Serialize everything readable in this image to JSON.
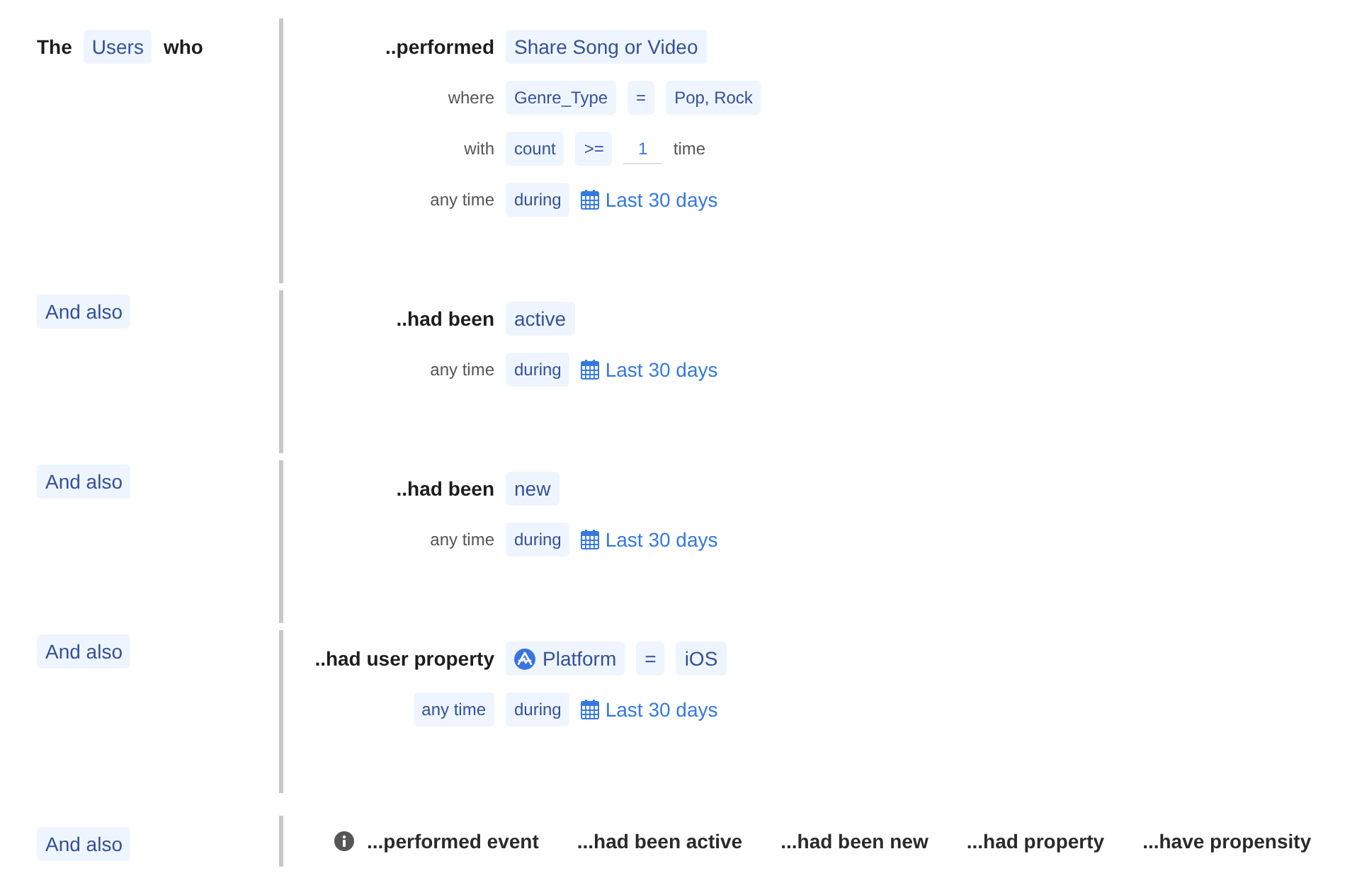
{
  "sections": [
    {
      "kind": "condition",
      "lead": {
        "kind": "intro",
        "words": [
          {
            "kind": "text",
            "text": "The"
          },
          {
            "kind": "pill",
            "text": "Users"
          },
          {
            "kind": "text",
            "text": "who"
          }
        ]
      },
      "rows": [
        {
          "label": {
            "kind": "heading",
            "text": "..performed"
          },
          "parts": [
            {
              "kind": "pill",
              "text": "Share Song or Video"
            }
          ]
        },
        {
          "label": {
            "kind": "plain",
            "text": "where"
          },
          "parts": [
            {
              "kind": "pill",
              "text": "Genre_Type"
            },
            {
              "kind": "pill",
              "text": "="
            },
            {
              "kind": "pill",
              "text": "Pop, Rock"
            }
          ]
        },
        {
          "label": {
            "kind": "plain",
            "text": "with"
          },
          "parts": [
            {
              "kind": "pill",
              "text": "count"
            },
            {
              "kind": "pill",
              "text": ">="
            },
            {
              "kind": "input",
              "text": "1"
            },
            {
              "kind": "text",
              "text": "time"
            }
          ]
        },
        {
          "label": {
            "kind": "plain",
            "text": "any time"
          },
          "parts": [
            {
              "kind": "pill",
              "text": "during"
            },
            {
              "kind": "date",
              "text": "Last 30 days"
            }
          ]
        }
      ]
    },
    {
      "kind": "condition",
      "lead": {
        "kind": "connector",
        "words": [
          {
            "kind": "pill",
            "text": "And also"
          }
        ]
      },
      "rows": [
        {
          "label": {
            "kind": "heading",
            "text": "..had been"
          },
          "parts": [
            {
              "kind": "pill",
              "text": "active"
            }
          ]
        },
        {
          "label": {
            "kind": "plain",
            "text": "any time"
          },
          "parts": [
            {
              "kind": "pill",
              "text": "during"
            },
            {
              "kind": "date",
              "text": "Last 30 days"
            }
          ]
        }
      ]
    },
    {
      "kind": "condition",
      "lead": {
        "kind": "connector",
        "words": [
          {
            "kind": "pill",
            "text": "And also"
          }
        ]
      },
      "rows": [
        {
          "label": {
            "kind": "heading",
            "text": "..had been"
          },
          "parts": [
            {
              "kind": "pill",
              "text": "new"
            }
          ]
        },
        {
          "label": {
            "kind": "plain",
            "text": "any time"
          },
          "parts": [
            {
              "kind": "pill",
              "text": "during"
            },
            {
              "kind": "date",
              "text": "Last 30 days"
            }
          ]
        }
      ]
    },
    {
      "kind": "condition",
      "lead": {
        "kind": "connector",
        "words": [
          {
            "kind": "pill",
            "text": "And also"
          }
        ]
      },
      "rows": [
        {
          "label": {
            "kind": "heading",
            "text": "..had user property"
          },
          "parts": [
            {
              "kind": "property",
              "text": "Platform"
            },
            {
              "kind": "pill",
              "text": "="
            },
            {
              "kind": "pill",
              "text": "iOS"
            }
          ]
        },
        {
          "label": {
            "kind": "pill",
            "text": "any time"
          },
          "parts": [
            {
              "kind": "pill",
              "text": "during"
            },
            {
              "kind": "date",
              "text": "Last 30 days"
            }
          ]
        }
      ]
    },
    {
      "kind": "picker",
      "lead": {
        "kind": "connector",
        "words": [
          {
            "kind": "pill",
            "text": "And also"
          }
        ]
      },
      "options": [
        "...performed event",
        "...had been active",
        "...had been new",
        "...had property",
        "...have propensity"
      ]
    }
  ]
}
